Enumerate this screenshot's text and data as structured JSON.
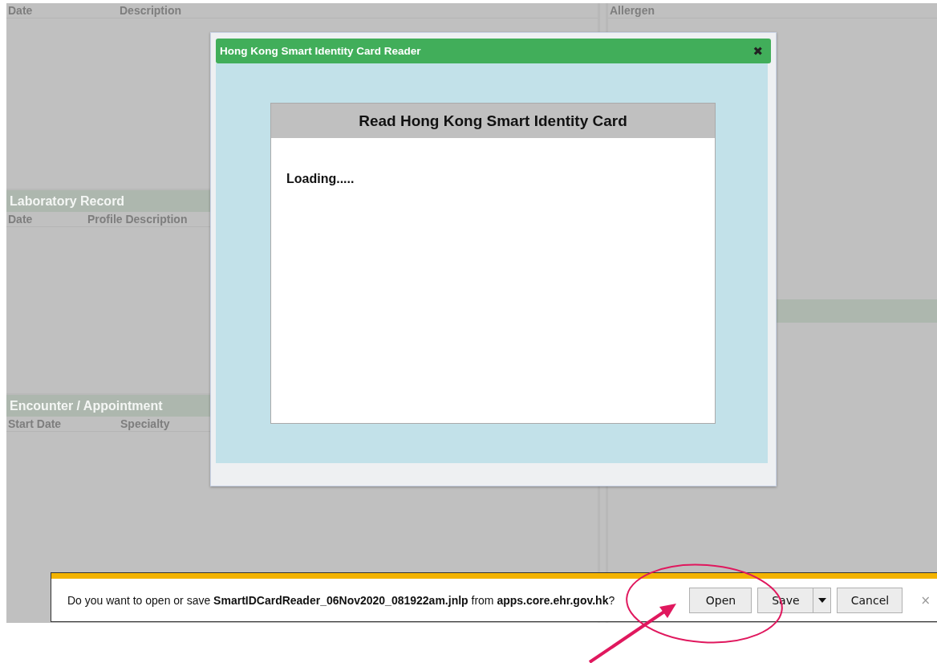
{
  "background": {
    "left": {
      "header_columns": [
        "Date",
        "Description"
      ],
      "sections": [
        {
          "title": "Laboratory Record",
          "columns": [
            "Date",
            "Profile Description"
          ]
        },
        {
          "title": "Encounter / Appointment",
          "columns": [
            "Start Date",
            "Specialty"
          ]
        }
      ]
    },
    "right": {
      "header_columns": [
        "Allergen"
      ]
    }
  },
  "dialog": {
    "title": "Hong Kong Smart Identity Card Reader",
    "close": "✖",
    "card_title": "Read Hong Kong Smart Identity Card",
    "message": "Loading....."
  },
  "download_bar": {
    "prompt": "Do you want to open or save **SmartIDCardReader_06Nov2020_081922am.jnlp** from **apps.core.ehr.gov.hk**?",
    "buttons": [
      {
        "label": "Open",
        "kind": "plain"
      },
      {
        "label": "Save",
        "kind": "split"
      },
      {
        "label": "Cancel",
        "kind": "plain"
      }
    ],
    "close": "×"
  }
}
